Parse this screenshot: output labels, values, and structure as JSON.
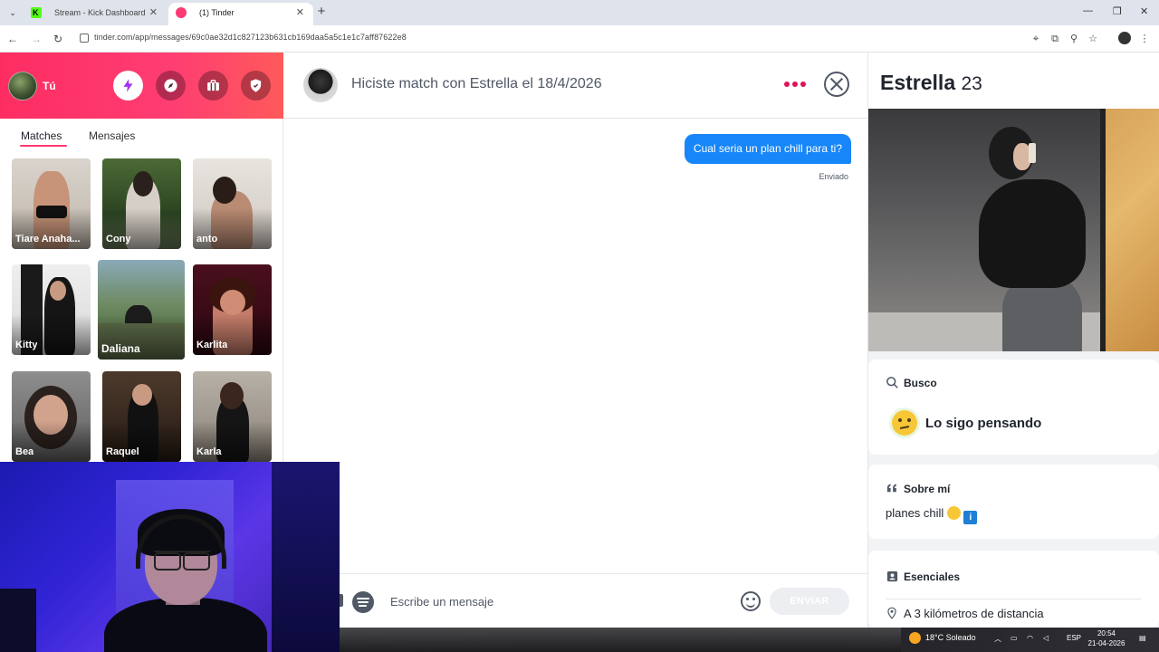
{
  "browser": {
    "tabs": [
      {
        "title": "Stream - Kick Dashboard",
        "favicon": "kick-icon"
      },
      {
        "title": "(1) Tinder",
        "favicon": "tinder-icon"
      }
    ],
    "url": "tinder.com/app/messages/69c0ae32d1c827123b631cb169daa5a5c1e1c7aff87622e8"
  },
  "sidebar": {
    "user_label": "Tú",
    "accent": "#fd3a73",
    "header_buttons": [
      "boost-icon",
      "explore-icon",
      "briefcase-icon",
      "shield-icon"
    ],
    "tabs": {
      "matches": "Matches",
      "messages": "Mensajes"
    },
    "matches": [
      {
        "name": "Tiare Anaha..."
      },
      {
        "name": "Cony"
      },
      {
        "name": "anto"
      },
      {
        "name": "Kitty"
      },
      {
        "name": "Daliana"
      },
      {
        "name": "Karlita"
      },
      {
        "name": "Bea"
      },
      {
        "name": "Raquel"
      },
      {
        "name": "Karla"
      }
    ]
  },
  "chat": {
    "title": "Hiciste match con Estrella el 18/4/2026",
    "messages": [
      {
        "text": "Cual seria un plan chill para ti?",
        "status": "Enviado",
        "color": "#1786f8"
      }
    ],
    "composer": {
      "placeholder": "Escribe un mensaje",
      "send_label": "ENVIAR"
    }
  },
  "profile": {
    "name": "Estrella",
    "age": "23",
    "looking_for": {
      "heading": "Busco",
      "value": "Lo sigo pensando"
    },
    "about": {
      "heading": "Sobre mí",
      "text": "planes chill"
    },
    "essentials": {
      "heading": "Esenciales",
      "distance": "A 3 kilómetros de distancia"
    }
  },
  "taskbar": {
    "weather": "18°C Soleado",
    "language": "ESP",
    "time": "20:54",
    "date": "21-04-2026"
  }
}
